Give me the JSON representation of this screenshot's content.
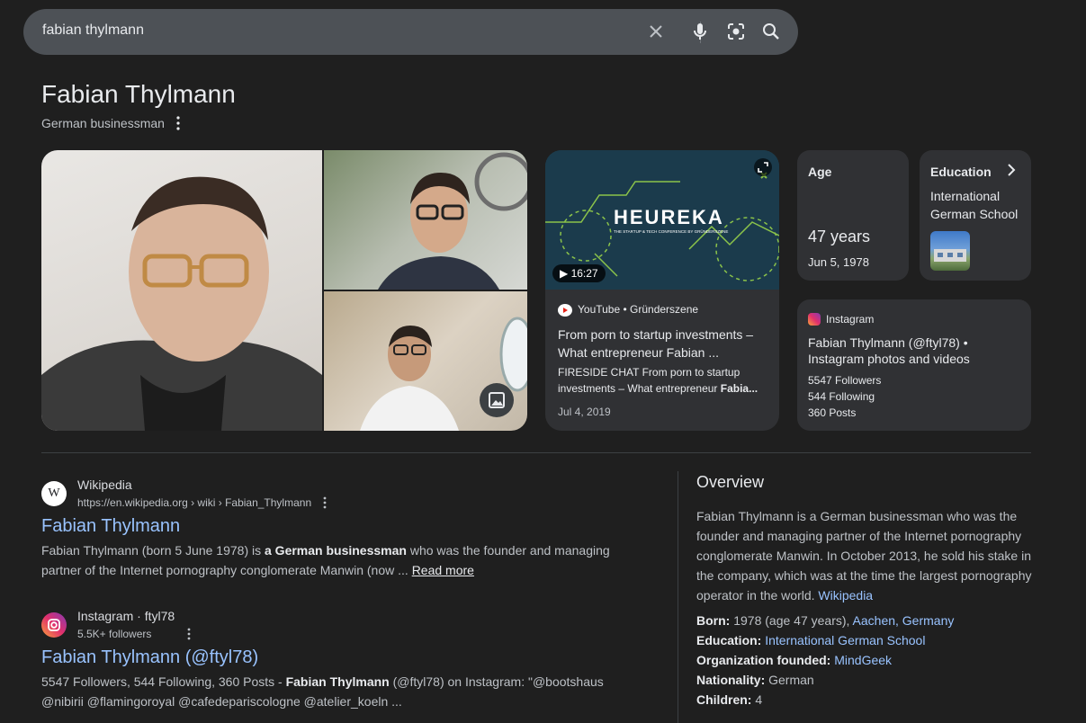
{
  "search": {
    "query": "fabian thylmann"
  },
  "kp": {
    "title": "Fabian Thylmann",
    "subtitle": "German businessman"
  },
  "video": {
    "duration": "16:27",
    "thumb_text": "HEUREKA",
    "thumb_subtext": "THE STARTUP & TECH CONFERENCE BY GRÜNDERSZENE",
    "source": "YouTube • Gründerszene",
    "title": "From porn to startup investments – What entrepreneur Fabian ...",
    "desc_plain": "FIRESIDE CHAT From porn to startup investments – What entrepreneur ",
    "desc_bold": "Fabia...",
    "date": "Jul 4, 2019"
  },
  "age_card": {
    "label": "Age",
    "value": "47 years",
    "date": "Jun 5, 1978"
  },
  "edu_card": {
    "label": "Education",
    "value": "International German School"
  },
  "ig_card": {
    "source": "Instagram",
    "title": "Fabian Thylmann (@ftyl78) • Instagram photos and videos",
    "followers": "5547 Followers",
    "following": "544 Following",
    "posts": "360 Posts"
  },
  "results": [
    {
      "site": "Wikipedia",
      "url": "https://en.wikipedia.org › wiki › Fabian_Thylmann",
      "title": "Fabian Thylmann",
      "s1": "Fabian Thylmann (born 5 June 1978) is ",
      "s2": "a German businessman",
      "s3": " who was the founder and managing partner of the Internet pornography conglomerate Manwin (now ... ",
      "more": "Read more"
    },
    {
      "site": "Instagram · ftyl78",
      "url": "5.5K+ followers",
      "title": "Fabian Thylmann (@ftyl78)",
      "s1": "5547 Followers, 544 Following, 360 Posts - ",
      "s2": "Fabian Thylmann",
      "s3": " (@ftyl78) on Instagram: \"@bootshaus @nibirii @flamingoroyal @cafedepariscologne @atelier_koeln ..."
    }
  ],
  "overview": {
    "title": "Overview",
    "desc": "Fabian Thylmann is a German businessman who was the founder and managing partner of the Internet pornography conglomerate Manwin. In October 2013, he sold his stake in the company, which was at the time the largest pornography operator in the world. ",
    "desc_link": "Wikipedia",
    "facts": [
      {
        "k": "Born:",
        "v": " 1978 (age 47 years), ",
        "link": "Aachen, Germany"
      },
      {
        "k": "Education:",
        "v": " ",
        "link": "International German School"
      },
      {
        "k": "Organization founded:",
        "v": " ",
        "link": "MindGeek"
      },
      {
        "k": "Nationality:",
        "v": " German",
        "link": ""
      },
      {
        "k": "Children:",
        "v": " 4",
        "link": ""
      }
    ]
  }
}
